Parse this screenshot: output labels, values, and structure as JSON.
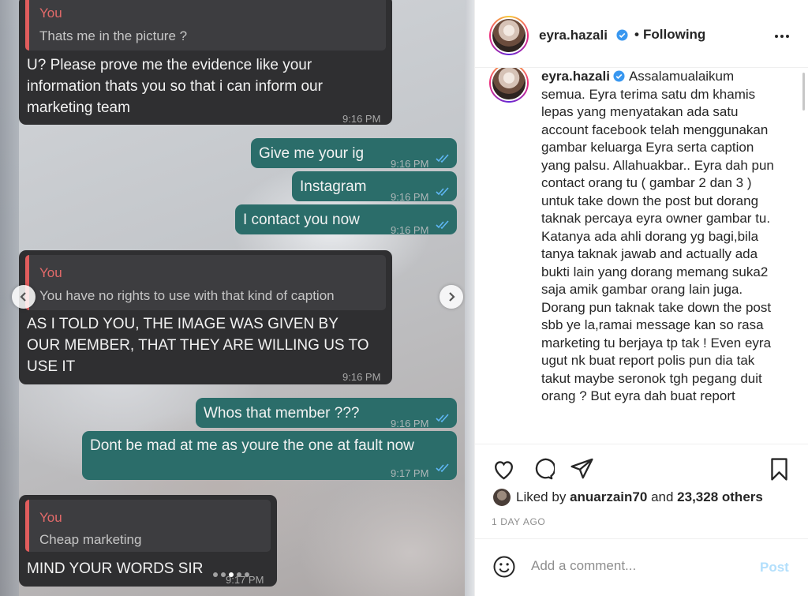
{
  "chat": {
    "msg1": {
      "quote_name": "You",
      "quote_text": "Thats me in the picture ?",
      "text": "U? Please prove me the evidence like your\ninformation thats you so that i can inform our\nmarketing team",
      "time": "9:16 PM"
    },
    "msg2": {
      "text": "Give me your ig",
      "time": "9:16 PM"
    },
    "msg3": {
      "text": "Instagram",
      "time": "9:16 PM"
    },
    "msg4": {
      "text": "I contact you now",
      "time": "9:16 PM"
    },
    "msg5": {
      "quote_name": "You",
      "quote_text": "You have no rights to use with that kind of caption",
      "text": "AS I TOLD YOU, THE IMAGE WAS GIVEN BY\nOUR MEMBER, THAT THEY ARE WILLING US TO\nUSE IT",
      "time": "9:16 PM"
    },
    "msg6": {
      "text": "Whos that member ???",
      "time": "9:16 PM"
    },
    "msg7": {
      "text": "Dont be mad at me as youre the one at fault now",
      "time": "9:17 PM"
    },
    "msg8": {
      "quote_name": "You",
      "quote_text": "Cheap marketing",
      "text": "MIND YOUR WORDS SIR",
      "time": "9:17 PM"
    }
  },
  "carousel": {
    "total_slides": 5,
    "active_slide": 3
  },
  "post": {
    "username": "eyra.hazali",
    "follow_status": "Following",
    "caption": "Assalamualaikum semua. Eyra terima satu dm khamis lepas yang menyatakan ada satu account facebook telah menggunakan gambar keluarga Eyra serta caption yang palsu. Allahuakbar.. Eyra dah pun contact orang tu ( gambar 2 dan 3 ) untuk take down the post but dorang taknak percaya eyra owner gambar tu. Katanya ada ahli dorang yg bagi,bila tanya taknak jawab and actually ada bukti lain yang dorang memang suka2 saja amik gambar orang lain juga. Dorang pun taknak take down the post sbb ye la,ramai message kan so rasa marketing tu berjaya tp tak ! Even eyra ugut nk buat report polis pun dia tak takut maybe seronok tgh pegang duit orang ? But eyra dah buat report",
    "liked_by_prefix": "Liked by",
    "liked_by_user": "anuarzain70",
    "liked_by_and": "and",
    "liked_by_others": "23,328 others",
    "date": "1 DAY AGO",
    "comment_placeholder": "Add a comment...",
    "post_label": "Post"
  },
  "colors": {
    "accent_blue": "#0095f6",
    "post_disabled": "#b2dffc",
    "verified": "#3897f0",
    "quote_bar": "#e15d5d",
    "outgoing_bubble": "#2b6d6a",
    "incoming_bubble": "#2f2f31"
  }
}
